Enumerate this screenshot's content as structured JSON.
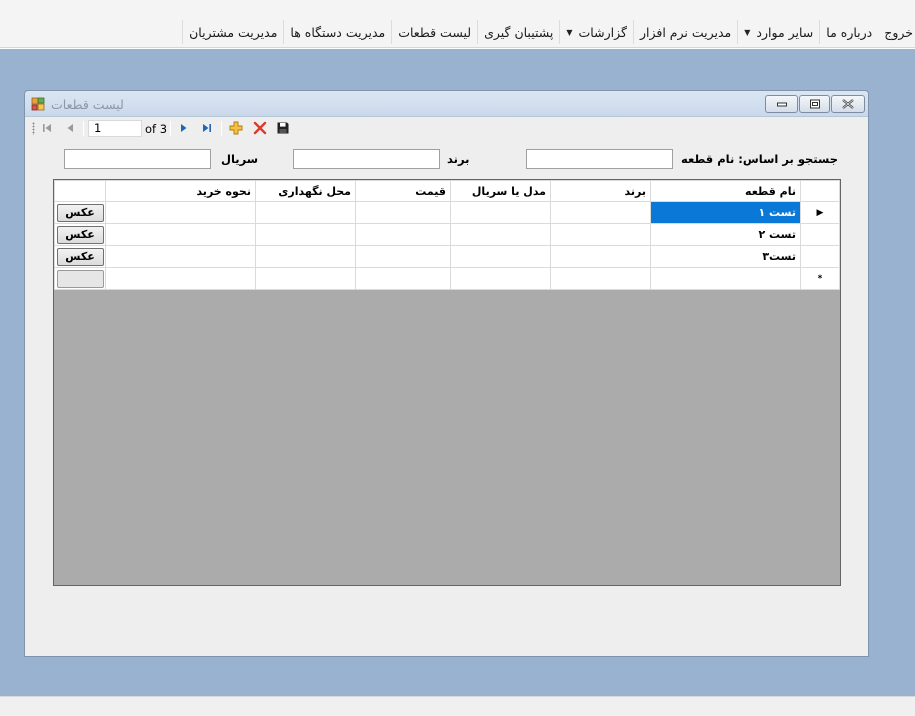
{
  "menu": {
    "items": [
      {
        "label": "مدیریت مشتریان",
        "dropdown": false
      },
      {
        "label": "مدیریت دستگاه ها",
        "dropdown": false
      },
      {
        "label": "لیست قطعات",
        "dropdown": false
      },
      {
        "label": "پشتیبان گیری",
        "dropdown": false
      },
      {
        "label": "گزارشات",
        "dropdown": true
      },
      {
        "label": "مدیریت نرم افزار",
        "dropdown": false
      },
      {
        "label": "سایر موارد",
        "dropdown": true
      },
      {
        "label": "درباره ما",
        "dropdown": false
      },
      {
        "label": "خروج",
        "dropdown": false
      }
    ]
  },
  "window": {
    "title": "لیست قطعات"
  },
  "navigator": {
    "position": "1",
    "count_label": "of 3"
  },
  "search": {
    "prefix_label": "جستجو بر اساس:",
    "name_label": "نام قطعه",
    "brand_label": "برند",
    "serial_label": "سریال",
    "name_value": "",
    "brand_value": "",
    "serial_value": ""
  },
  "grid": {
    "columns": [
      "نام قطعه",
      "برند",
      "مدل یا سریال",
      "قیمت",
      "محل نگهداری",
      "نحوه خرید",
      ""
    ],
    "rows": [
      {
        "name": "تست ۱",
        "brand": "",
        "model": "",
        "price": "",
        "location": "",
        "purchase": "",
        "button": "عکس",
        "current": true
      },
      {
        "name": "تست ۲",
        "brand": "",
        "model": "",
        "price": "",
        "location": "",
        "purchase": "",
        "button": "عکس",
        "current": false
      },
      {
        "name": "تست۳",
        "brand": "",
        "model": "",
        "price": "",
        "location": "",
        "purchase": "",
        "button": "عکس",
        "current": false
      }
    ],
    "new_row_marker": "*",
    "current_row_marker": "▶"
  },
  "colors": {
    "workspace": "#98b2cf",
    "selection": "#0a78d7",
    "grid_background": "#ababab"
  }
}
